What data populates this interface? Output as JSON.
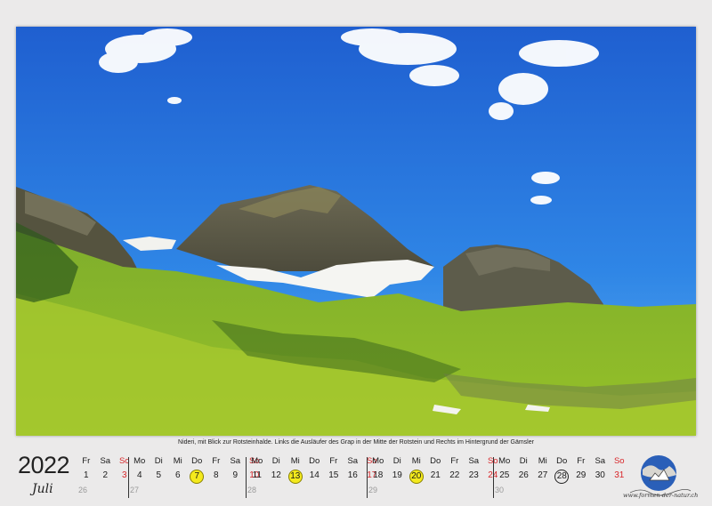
{
  "photo": {
    "alt": "mountain-landscape"
  },
  "caption": "Nideri, mit Blick zur Rotsteinhalde. Links die Ausläufer des Grap in der Mitte der Rotstein und Rechts im Hintergrund der Gämsler",
  "calendar": {
    "year": "2022",
    "month": "Juli",
    "weeks": [
      {
        "kw": "26",
        "days": [
          {
            "h": "Fr",
            "d": "1"
          },
          {
            "h": "Sa",
            "d": "2"
          },
          {
            "h": "So",
            "d": "3",
            "red": true
          }
        ]
      },
      {
        "kw": "27",
        "days": [
          {
            "h": "Mo",
            "d": "4"
          },
          {
            "h": "Di",
            "d": "5"
          },
          {
            "h": "Mi",
            "d": "6"
          },
          {
            "h": "Do",
            "d": "7",
            "mark": "yellow"
          },
          {
            "h": "Fr",
            "d": "8"
          },
          {
            "h": "Sa",
            "d": "9"
          },
          {
            "h": "So",
            "d": "10",
            "red": true
          }
        ]
      },
      {
        "kw": "28",
        "days": [
          {
            "h": "Mo",
            "d": "11"
          },
          {
            "h": "Di",
            "d": "12"
          },
          {
            "h": "Mi",
            "d": "13",
            "mark": "yellow"
          },
          {
            "h": "Do",
            "d": "14"
          },
          {
            "h": "Fr",
            "d": "15"
          },
          {
            "h": "Sa",
            "d": "16"
          },
          {
            "h": "So",
            "d": "17",
            "red": true
          }
        ]
      },
      {
        "kw": "29",
        "days": [
          {
            "h": "Mo",
            "d": "18"
          },
          {
            "h": "Di",
            "d": "19"
          },
          {
            "h": "Mi",
            "d": "20",
            "mark": "yellow"
          },
          {
            "h": "Do",
            "d": "21"
          },
          {
            "h": "Fr",
            "d": "22"
          },
          {
            "h": "Sa",
            "d": "23"
          },
          {
            "h": "So",
            "d": "24",
            "red": true
          }
        ]
      },
      {
        "kw": "30",
        "days": [
          {
            "h": "Mo",
            "d": "25"
          },
          {
            "h": "Di",
            "d": "26"
          },
          {
            "h": "Mi",
            "d": "27"
          },
          {
            "h": "Do",
            "d": "28",
            "mark": "ring"
          },
          {
            "h": "Fr",
            "d": "29"
          },
          {
            "h": "Sa",
            "d": "30"
          },
          {
            "h": "So",
            "d": "31",
            "red": true
          }
        ]
      }
    ]
  },
  "logo": {
    "text": "www.formen-der-natur.ch",
    "icon": "globe-mountain-logo"
  },
  "colors": {
    "sunday": "#d8262a",
    "highlight": "#f4ea1d"
  }
}
